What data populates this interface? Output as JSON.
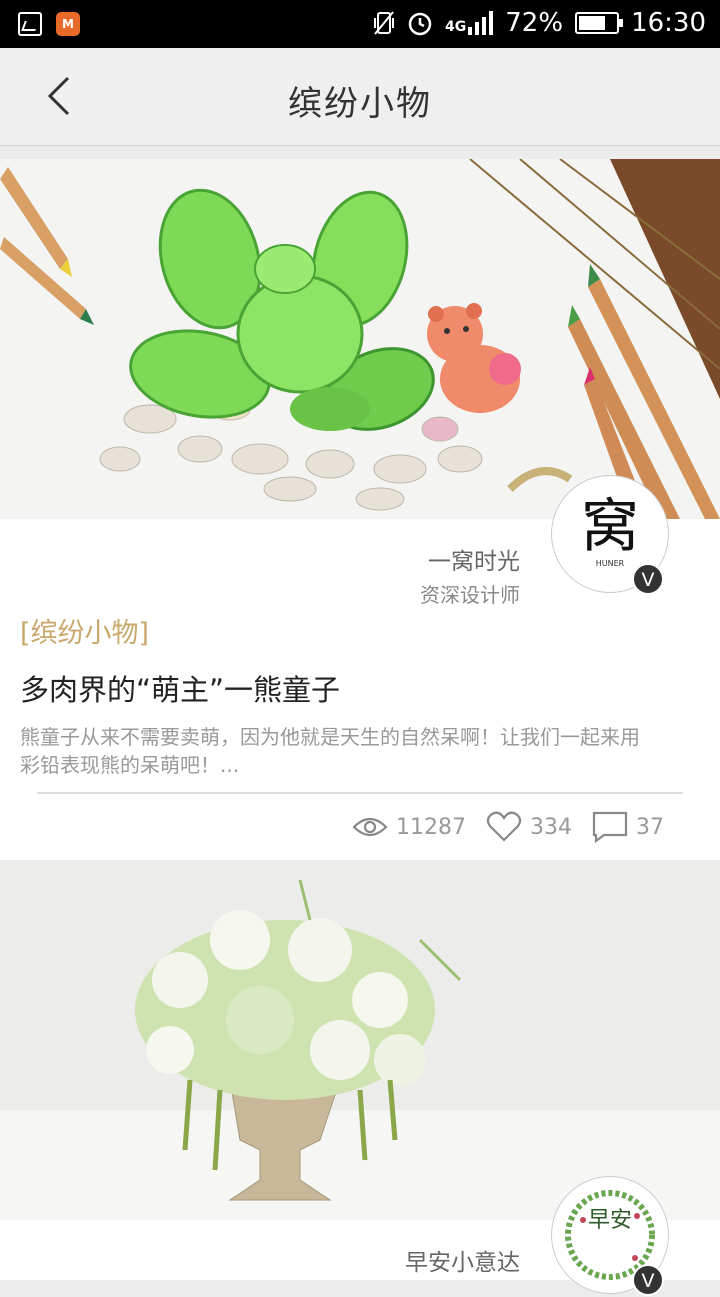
{
  "status_bar": {
    "network": "4G",
    "battery": "72%",
    "battery_level": 0.72,
    "time": "16:30",
    "left_icons": [
      "gallery-icon",
      "app-notification-icon"
    ],
    "right_icons": [
      "vibrate-icon",
      "alarm-icon",
      "signal-icon",
      "battery-icon"
    ]
  },
  "nav": {
    "title": "缤纷小物",
    "back_icon": "chevron-left-icon"
  },
  "posts": [
    {
      "image_alt": "colored pencil drawing of a green succulent with a bear",
      "author": {
        "name": "一窝时光",
        "role": "资深设计师",
        "avatar_text": "窝",
        "avatar_sub": "HUNER",
        "verified": "V"
      },
      "category": "[缤纷小物]",
      "title": "多肉界的“萌主”一熊童子",
      "summary": "熊童子从来不需要卖萌，因为他就是天生的自然呆啊！让我们一起来用彩铅表现熊的呆萌吧！...",
      "stats": {
        "views": "11287",
        "likes": "334",
        "comments": "37"
      }
    },
    {
      "image_alt": "white flower arrangement in a stone vase",
      "author": {
        "name": "早安小意达",
        "avatar_text": "早安",
        "verified": "V"
      }
    }
  ],
  "colors": {
    "category": "#c9a86c",
    "status_bar": "#000000",
    "nav_bg": "#efefef"
  }
}
